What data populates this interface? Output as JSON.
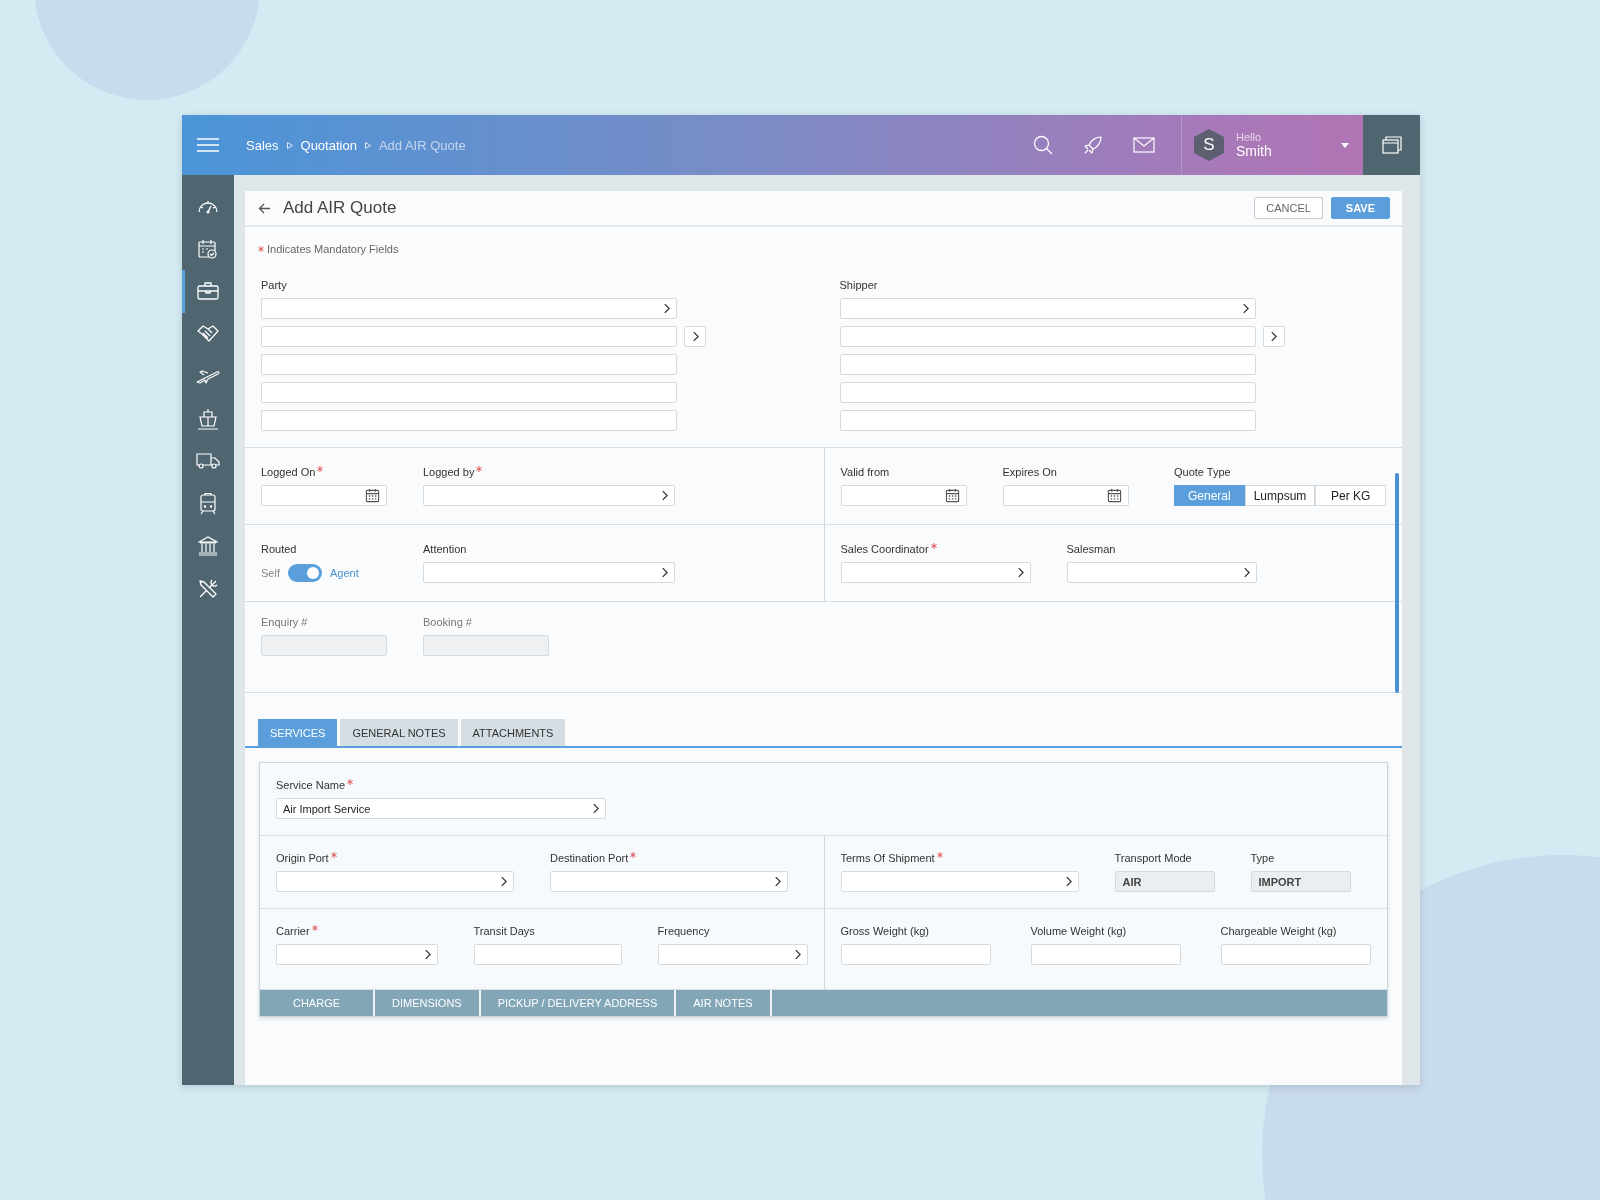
{
  "header": {
    "breadcrumb": [
      {
        "label": "Sales",
        "current": false
      },
      {
        "label": "Quotation",
        "current": false
      },
      {
        "label": "Add AIR Quote",
        "current": true
      }
    ],
    "user": {
      "initial": "S",
      "greeting": "Hello",
      "name": "Smith"
    }
  },
  "sidebar": {
    "items": [
      {
        "selected": false
      },
      {
        "selected": false
      },
      {
        "selected": true
      },
      {
        "selected": false
      },
      {
        "selected": false
      },
      {
        "selected": false
      },
      {
        "selected": false
      },
      {
        "selected": false
      },
      {
        "selected": false
      },
      {
        "selected": false
      }
    ]
  },
  "page": {
    "title": "Add AIR Quote",
    "buttons": [
      {
        "label": "CANCEL",
        "kind": "secondary"
      },
      {
        "label": "SAVE",
        "kind": "primary"
      }
    ],
    "mandatory_note": "Indicates Mandatory Fields"
  },
  "form": {
    "rows": [
      {
        "columns": [
          [
            {
              "kind": "address",
              "label": "Party",
              "required": false,
              "lines": [
                {
                  "kind": "lookup",
                  "button": false
                },
                {
                  "kind": "text",
                  "button": true
                },
                {
                  "kind": "text",
                  "button": false
                },
                {
                  "kind": "text",
                  "button": false
                },
                {
                  "kind": "text",
                  "button": false
                }
              ]
            }
          ],
          [
            {
              "kind": "address",
              "label": "Shipper",
              "required": false,
              "lines": [
                {
                  "kind": "lookup",
                  "button": false
                },
                {
                  "kind": "text",
                  "button": true
                },
                {
                  "kind": "text",
                  "button": false
                },
                {
                  "kind": "text",
                  "button": false
                },
                {
                  "kind": "text",
                  "button": false
                }
              ]
            }
          ]
        ]
      },
      {
        "columns": [
          [
            {
              "kind": "date",
              "label": "Logged On",
              "required": true
            },
            {
              "kind": "lookup",
              "label": "Logged by",
              "required": true
            }
          ],
          [
            {
              "kind": "date",
              "label": "Valid from",
              "required": false
            },
            {
              "kind": "date",
              "label": "Expires On",
              "required": false
            },
            {
              "kind": "segmented",
              "label": "Quote Type",
              "required": false,
              "options": [
                {
                  "label": "General",
                  "selected": true
                },
                {
                  "label": "Lumpsum",
                  "selected": false
                },
                {
                  "label": "Per KG",
                  "selected": false
                }
              ]
            }
          ]
        ]
      },
      {
        "columns": [
          [
            {
              "kind": "toggle",
              "label": "Routed",
              "required": false,
              "off_label": "Self",
              "on_label": "Agent",
              "on": true
            },
            {
              "kind": "lookup",
              "label": "Attention",
              "required": false
            }
          ],
          [
            {
              "kind": "lookup",
              "label": "Sales Coordinator",
              "required": true
            },
            {
              "kind": "lookup",
              "label": "Salesman",
              "required": false
            }
          ]
        ]
      },
      {
        "columns": [
          [
            {
              "kind": "disabled",
              "label": "Enquiry #",
              "required": false
            },
            {
              "kind": "disabled",
              "label": "Booking #",
              "required": false
            }
          ]
        ]
      }
    ]
  },
  "tabs": [
    {
      "label": "SERVICES",
      "selected": true
    },
    {
      "label": "GENERAL NOTES",
      "selected": false
    },
    {
      "label": "ATTACHMENTS",
      "selected": false
    }
  ],
  "service": {
    "rows": [
      {
        "columns": [
          [
            {
              "kind": "lookup",
              "label": "Service Name",
              "required": true,
              "value": "Air Import Service"
            }
          ]
        ]
      },
      {
        "columns": [
          [
            {
              "kind": "lookup",
              "label": "Origin Port",
              "required": true
            },
            {
              "kind": "lookup",
              "label": "Destination Port",
              "required": true
            }
          ],
          [
            {
              "kind": "lookup",
              "label": "Terms Of Shipment",
              "required": true
            },
            {
              "kind": "readonly",
              "label": "Transport Mode",
              "required": false,
              "value": "AIR"
            },
            {
              "kind": "readonly",
              "label": "Type",
              "required": false,
              "value": "IMPORT"
            }
          ]
        ]
      },
      {
        "columns": [
          [
            {
              "kind": "lookup",
              "label": "Carrier",
              "required": true
            },
            {
              "kind": "text",
              "label": "Transit Days",
              "required": false
            },
            {
              "kind": "lookup",
              "label": "Frequency",
              "required": false
            }
          ],
          [
            {
              "kind": "text",
              "label": "Gross Weight (kg)",
              "required": false
            },
            {
              "kind": "text",
              "label": "Volume Weight (kg)",
              "required": false
            },
            {
              "kind": "text",
              "label": "Chargeable Weight (kg)",
              "required": false
            }
          ]
        ]
      }
    ],
    "subtabs": [
      {
        "label": "CHARGE"
      },
      {
        "label": "DIMENSIONS"
      },
      {
        "label": "PICKUP / DELIVERY ADDRESS"
      },
      {
        "label": "AIR NOTES"
      }
    ]
  }
}
